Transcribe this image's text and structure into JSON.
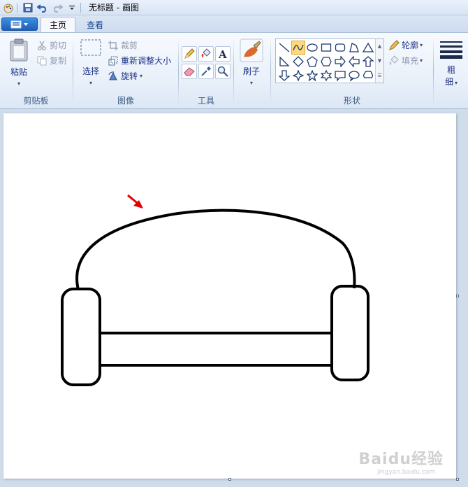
{
  "window": {
    "title": "无标题 - 画图"
  },
  "tabs": [
    {
      "label": "主页"
    },
    {
      "label": "查看"
    }
  ],
  "clipboard": {
    "paste_label": "粘贴",
    "cut_label": "剪切",
    "copy_label": "复制",
    "group_label": "剪贴板"
  },
  "image": {
    "select_label": "选择",
    "crop_label": "裁剪",
    "resize_label": "重新调整大小",
    "rotate_label": "旋转",
    "group_label": "图像"
  },
  "tools": {
    "group_label": "工具",
    "items": [
      "pencil-icon",
      "fill-icon",
      "text-icon",
      "eraser-icon",
      "color-picker-icon",
      "magnifier-icon"
    ]
  },
  "brushes": {
    "label": "刷子"
  },
  "shapes": {
    "outline_label": "轮廓",
    "fill_label": "填充",
    "group_label": "形状",
    "selected": "curve"
  },
  "size": {
    "label_line1": "粗",
    "label_line2": "细"
  },
  "watermark": {
    "text": "Baidu经验",
    "sub": "jingyan.baidu.com"
  },
  "colors": {
    "accent": "#1e5fb8",
    "arrow": "#e00000",
    "selected_shape": "#ffd97a"
  }
}
